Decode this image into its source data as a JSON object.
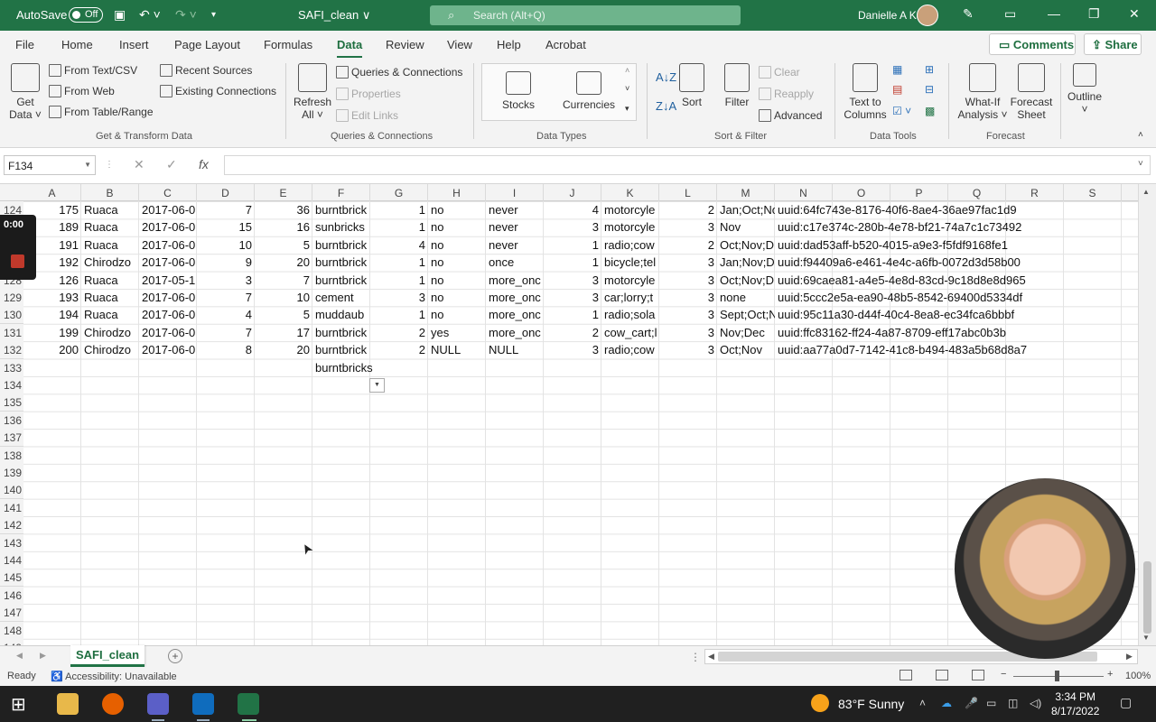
{
  "titlebar": {
    "autosave_label": "AutoSave",
    "autosave_state": "Off",
    "doc_title": "SAFI_clean ∨",
    "search_placeholder": "Search (Alt+Q)",
    "user_name": "Danielle A Kane"
  },
  "menu": {
    "tabs": [
      "File",
      "Home",
      "Insert",
      "Page Layout",
      "Formulas",
      "Data",
      "Review",
      "View",
      "Help",
      "Acrobat"
    ],
    "active": "Data",
    "comments": "Comments",
    "share": "Share"
  },
  "ribbon": {
    "get_data": "Get\nData ˅",
    "get_data_l1": "Get",
    "get_data_l2": "Data ˅",
    "from_text": "From Text/CSV",
    "from_web": "From Web",
    "from_table": "From Table/Range",
    "recent_sources": "Recent Sources",
    "existing_connections": "Existing Connections",
    "group_get_transform": "Get & Transform Data",
    "refresh_l1": "Refresh",
    "refresh_l2": "All ˅",
    "queries_connections": "Queries & Connections",
    "properties": "Properties",
    "edit_links": "Edit Links",
    "group_queries": "Queries & Connections",
    "stocks": "Stocks",
    "currencies": "Currencies",
    "group_data_types": "Data Types",
    "sort": "Sort",
    "filter": "Filter",
    "clear": "Clear",
    "reapply": "Reapply",
    "advanced": "Advanced",
    "group_sort_filter": "Sort & Filter",
    "text_to_columns_l1": "Text to",
    "text_to_columns_l2": "Columns",
    "group_data_tools": "Data Tools",
    "what_if_l1": "What-If",
    "what_if_l2": "Analysis ˅",
    "forecast_sheet_l1": "Forecast",
    "forecast_sheet_l2": "Sheet",
    "group_forecast": "Forecast",
    "outline": "Outline"
  },
  "formula_bar": {
    "name_box": "F134",
    "cancel": "✕",
    "enter": "✓",
    "fx": "fx",
    "content": ""
  },
  "columns": [
    "A",
    "B",
    "C",
    "D",
    "E",
    "F",
    "G",
    "H",
    "I",
    "J",
    "K",
    "L",
    "M",
    "N",
    "O",
    "P",
    "Q",
    "R",
    "S"
  ],
  "row_numbers": [
    "124",
    "125",
    "",
    "",
    "128",
    "129",
    "130",
    "131",
    "132",
    "133",
    "134",
    "135",
    "136",
    "137",
    "138",
    "139",
    "140",
    "141",
    "142",
    "143",
    "144",
    "145",
    "146",
    "147",
    "148",
    "149"
  ],
  "rows": [
    [
      "175",
      "Ruaca",
      "2017-06-0",
      "7",
      "36",
      "burntbrick",
      "1",
      "no",
      "never",
      "4",
      "motorcyle",
      "2",
      "Jan;Oct;No",
      "uuid:64fc743e-8176-40f6-8ae4-36ae97fac1d9"
    ],
    [
      "189",
      "Ruaca",
      "2017-06-0",
      "15",
      "16",
      "sunbricks",
      "1",
      "no",
      "never",
      "3",
      "motorcyle",
      "3",
      "Nov",
      "uuid:c17e374c-280b-4e78-bf21-74a7c1c73492"
    ],
    [
      "191",
      "Ruaca",
      "2017-06-0",
      "10",
      "5",
      "burntbrick",
      "4",
      "no",
      "never",
      "1",
      "radio;cow",
      "2",
      "Oct;Nov;D",
      "uuid:dad53aff-b520-4015-a9e3-f5fdf9168fe1"
    ],
    [
      "192",
      "Chirodzo",
      "2017-06-0",
      "9",
      "20",
      "burntbrick",
      "1",
      "no",
      "once",
      "1",
      "bicycle;tel",
      "3",
      "Jan;Nov;D",
      "uuid:f94409a6-e461-4e4c-a6fb-0072d3d58b00"
    ],
    [
      "126",
      "Ruaca",
      "2017-05-1",
      "3",
      "7",
      "burntbrick",
      "1",
      "no",
      "more_onc",
      "3",
      "motorcyle",
      "3",
      "Oct;Nov;D",
      "uuid:69caea81-a4e5-4e8d-83cd-9c18d8e8d965"
    ],
    [
      "193",
      "Ruaca",
      "2017-06-0",
      "7",
      "10",
      "cement",
      "3",
      "no",
      "more_onc",
      "3",
      "car;lorry;t",
      "3",
      "none",
      "uuid:5ccc2e5a-ea90-48b5-8542-69400d5334df"
    ],
    [
      "194",
      "Ruaca",
      "2017-06-0",
      "4",
      "5",
      "muddaub",
      "1",
      "no",
      "more_onc",
      "1",
      "radio;sola",
      "3",
      "Sept;Oct;N",
      "uuid:95c11a30-d44f-40c4-8ea8-ec34fca6bbbf"
    ],
    [
      "199",
      "Chirodzo",
      "2017-06-0",
      "7",
      "17",
      "burntbrick",
      "2",
      "yes",
      "more_onc",
      "2",
      "cow_cart;l",
      "3",
      "Nov;Dec",
      "uuid:ffc83162-ff24-4a87-8709-eff17abc0b3b"
    ],
    [
      "200",
      "Chirodzo",
      "2017-06-0",
      "8",
      "20",
      "burntbrick",
      "2",
      "NULL",
      "NULL",
      "3",
      "radio;cow",
      "3",
      "Oct;Nov",
      "uuid:aa77a0d7-7142-41c8-b494-483a5b68d8a7"
    ]
  ],
  "f133_value": "burntbricks",
  "recording": {
    "time": "0:00"
  },
  "sheet_tab": "SAFI_clean",
  "status": {
    "ready": "Ready",
    "accessibility": "Accessibility: Unavailable",
    "zoom": "100%"
  },
  "taskbar": {
    "weather": "83°F  Sunny",
    "time": "3:34 PM",
    "date": "8/17/2022"
  }
}
